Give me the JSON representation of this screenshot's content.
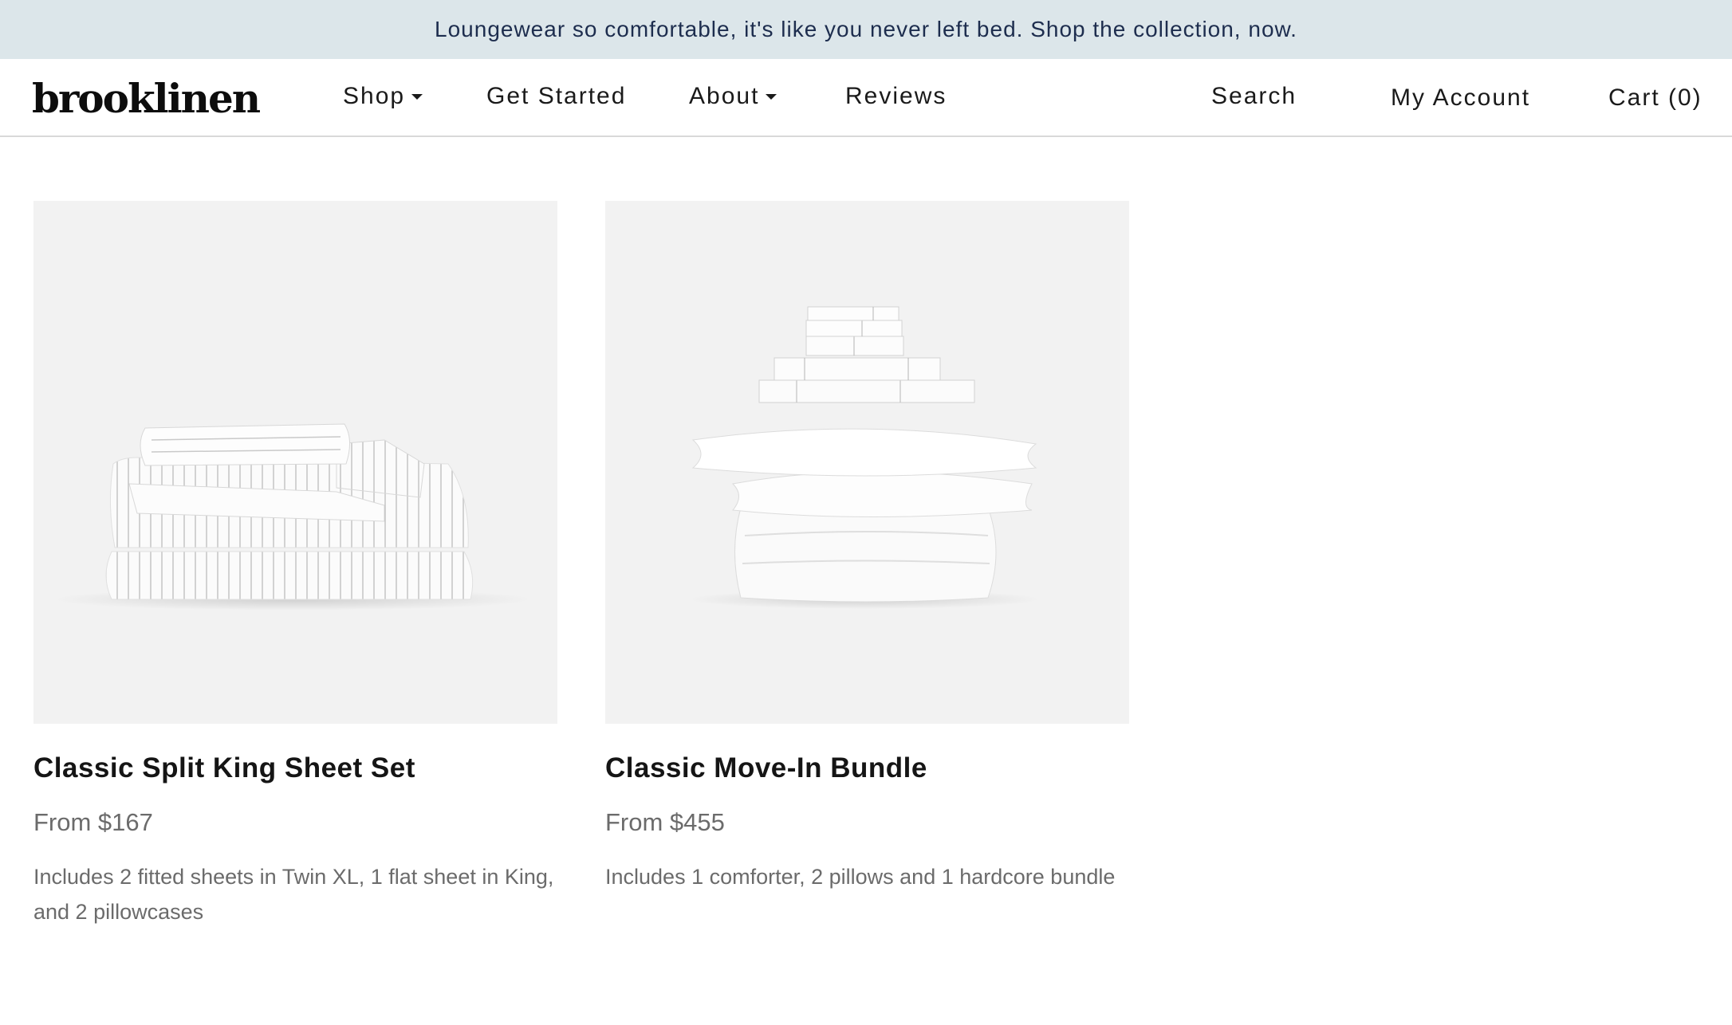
{
  "announcement": "Loungewear so comfortable, it's like you never left bed. Shop the collection, now.",
  "header": {
    "logo": "brooklinen",
    "nav": [
      {
        "label": "Shop",
        "dropdown": true
      },
      {
        "label": "Get Started",
        "dropdown": false
      },
      {
        "label": "About",
        "dropdown": true
      },
      {
        "label": "Reviews",
        "dropdown": false
      }
    ],
    "search": "Search",
    "account": "My Account",
    "cart": "Cart (0)"
  },
  "products": [
    {
      "title": "Classic Split King Sheet Set",
      "price": "From $167",
      "description": "Includes 2 fitted sheets in Twin XL, 1 flat sheet in King, and 2 pillowcases"
    },
    {
      "title": "Classic Move-In Bundle",
      "price": "From $455",
      "description": "Includes 1 comforter, 2 pillows and 1 hardcore bundle"
    }
  ],
  "colors": {
    "announcement_bg": "#dce6ea",
    "announcement_text": "#1d2d4e",
    "image_bg": "#f2f2f2"
  }
}
